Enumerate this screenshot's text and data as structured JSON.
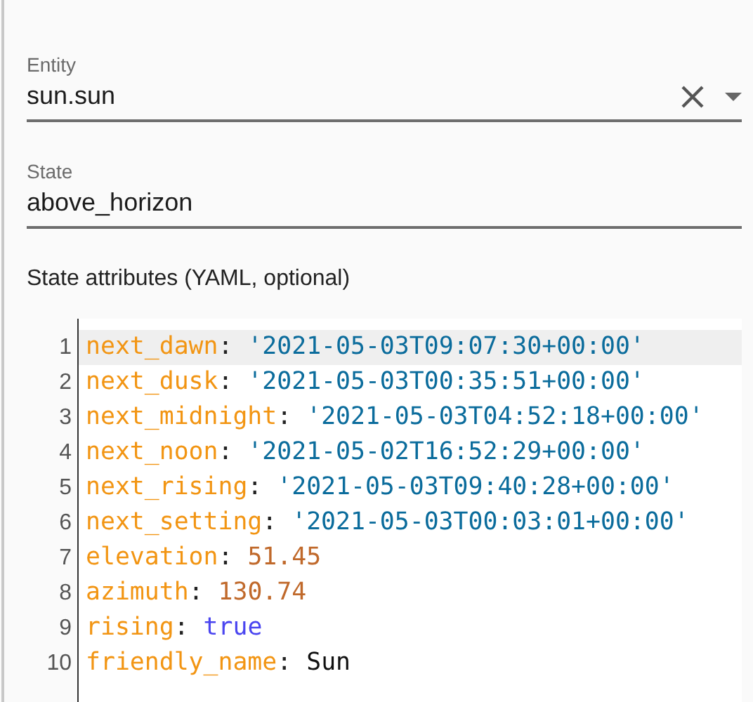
{
  "entity_field": {
    "label": "Entity",
    "value": "sun.sun"
  },
  "state_field": {
    "label": "State",
    "value": "above_horizon"
  },
  "attributes": {
    "label": "State attributes (YAML, optional)",
    "lines": [
      {
        "number": "1",
        "key": "next_dawn",
        "colon": ":",
        "value": "'2021-05-03T09:07:30+00:00'",
        "kind": "string",
        "active": true
      },
      {
        "number": "2",
        "key": "next_dusk",
        "colon": ":",
        "value": "'2021-05-03T00:35:51+00:00'",
        "kind": "string",
        "active": false
      },
      {
        "number": "3",
        "key": "next_midnight",
        "colon": ":",
        "value": "'2021-05-03T04:52:18+00:00'",
        "kind": "string",
        "active": false
      },
      {
        "number": "4",
        "key": "next_noon",
        "colon": ":",
        "value": "'2021-05-02T16:52:29+00:00'",
        "kind": "string",
        "active": false
      },
      {
        "number": "5",
        "key": "next_rising",
        "colon": ":",
        "value": "'2021-05-03T09:40:28+00:00'",
        "kind": "string",
        "active": false
      },
      {
        "number": "6",
        "key": "next_setting",
        "colon": ":",
        "value": "'2021-05-03T00:03:01+00:00'",
        "kind": "string",
        "active": false
      },
      {
        "number": "7",
        "key": "elevation",
        "colon": ":",
        "value": "51.45",
        "kind": "number",
        "active": false
      },
      {
        "number": "8",
        "key": "azimuth",
        "colon": ":",
        "value": "130.74",
        "kind": "number",
        "active": false
      },
      {
        "number": "9",
        "key": "rising",
        "colon": ":",
        "value": "true",
        "kind": "boolean",
        "active": false
      },
      {
        "number": "10",
        "key": "friendly_name",
        "colon": ":",
        "value": "Sun",
        "kind": "plain",
        "active": false
      }
    ]
  }
}
